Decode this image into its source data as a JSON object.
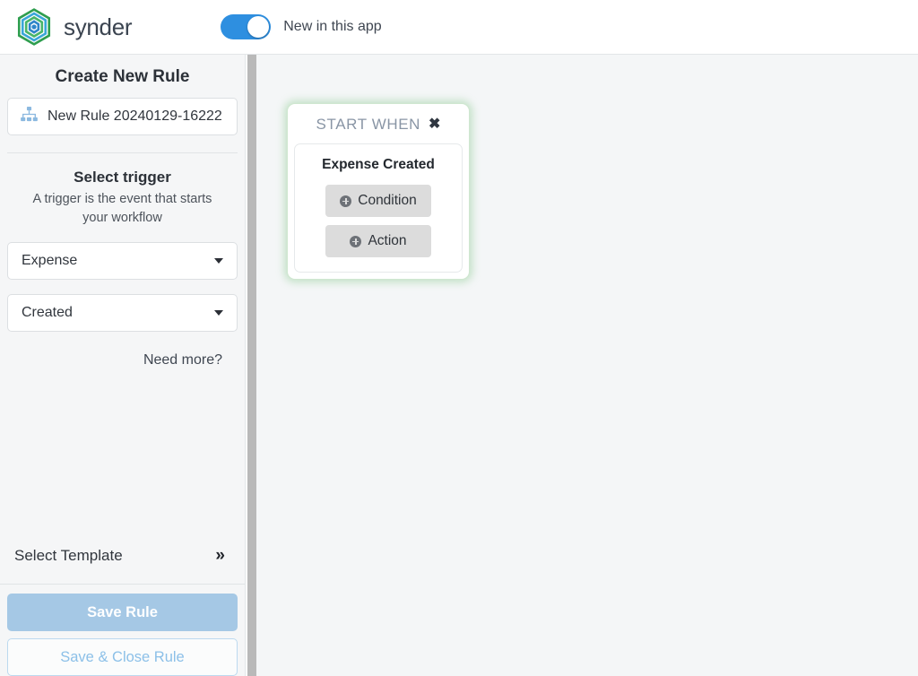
{
  "topbar": {
    "brand_name": "synder",
    "logo_icon": "synder-hex-logo",
    "toggle_state": "on",
    "toggle_label": "New in this app"
  },
  "sidebar": {
    "title": "Create New Rule",
    "rule_name": {
      "icon": "sitemap-icon",
      "value": "New Rule 20240129-16222"
    },
    "trigger_heading": "Select trigger",
    "trigger_help": "A trigger is the event that starts your workflow",
    "selects": [
      {
        "name": "trigger-object",
        "value": "Expense"
      },
      {
        "name": "trigger-event",
        "value": "Created"
      }
    ],
    "need_more_label": "Need more?",
    "select_template_label": "Select Template",
    "select_template_icon": "chevron-double-right-icon",
    "save_rule_label": "Save Rule",
    "save_close_rule_label": "Save & Close Rule"
  },
  "canvas": {
    "node": {
      "header_title": "START WHEN",
      "close_icon": "close-x-icon",
      "event_label": "Expense Created",
      "buttons": [
        {
          "name": "add-condition",
          "label": "Condition",
          "icon": "plus-circle-icon"
        },
        {
          "name": "add-action",
          "label": "Action",
          "icon": "plus-circle-icon"
        }
      ]
    }
  },
  "colors": {
    "toggle_on": "#2e8fe0",
    "node_glow": "#74c17a",
    "save_rule_bg": "#a5c8e5",
    "save_close_text": "#8cc0e8",
    "canvas_bg": "#f4f6f7",
    "sidebar_bg": "#f5f6f7"
  }
}
